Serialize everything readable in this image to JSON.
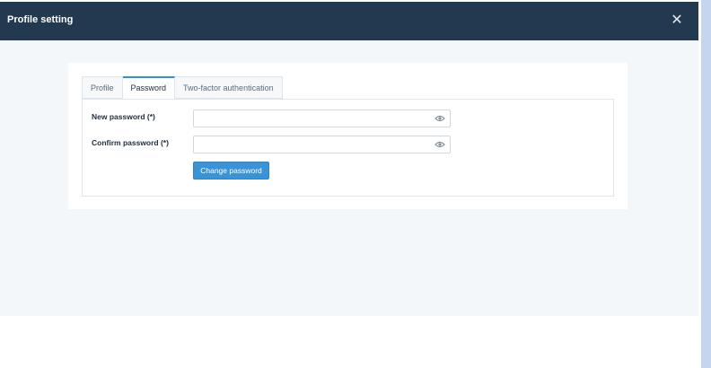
{
  "modal": {
    "title": "Profile setting",
    "close_icon": "close-icon"
  },
  "tabs": [
    {
      "label": "Profile",
      "active": false
    },
    {
      "label": "Password",
      "active": true
    },
    {
      "label": "Two-factor authentication",
      "active": false
    }
  ],
  "password_form": {
    "new_password": {
      "label": "New password (*)",
      "value": "",
      "icon": "eye-icon"
    },
    "confirm_password": {
      "label": "Confirm password (*)",
      "value": "",
      "icon": "eye-icon"
    },
    "submit_label": "Change password"
  },
  "colors": {
    "header_bg": "#23394f",
    "modal_bg": "#f4f7fa",
    "accent": "#3a93d6",
    "scrollbar": "#c5d5ef"
  }
}
